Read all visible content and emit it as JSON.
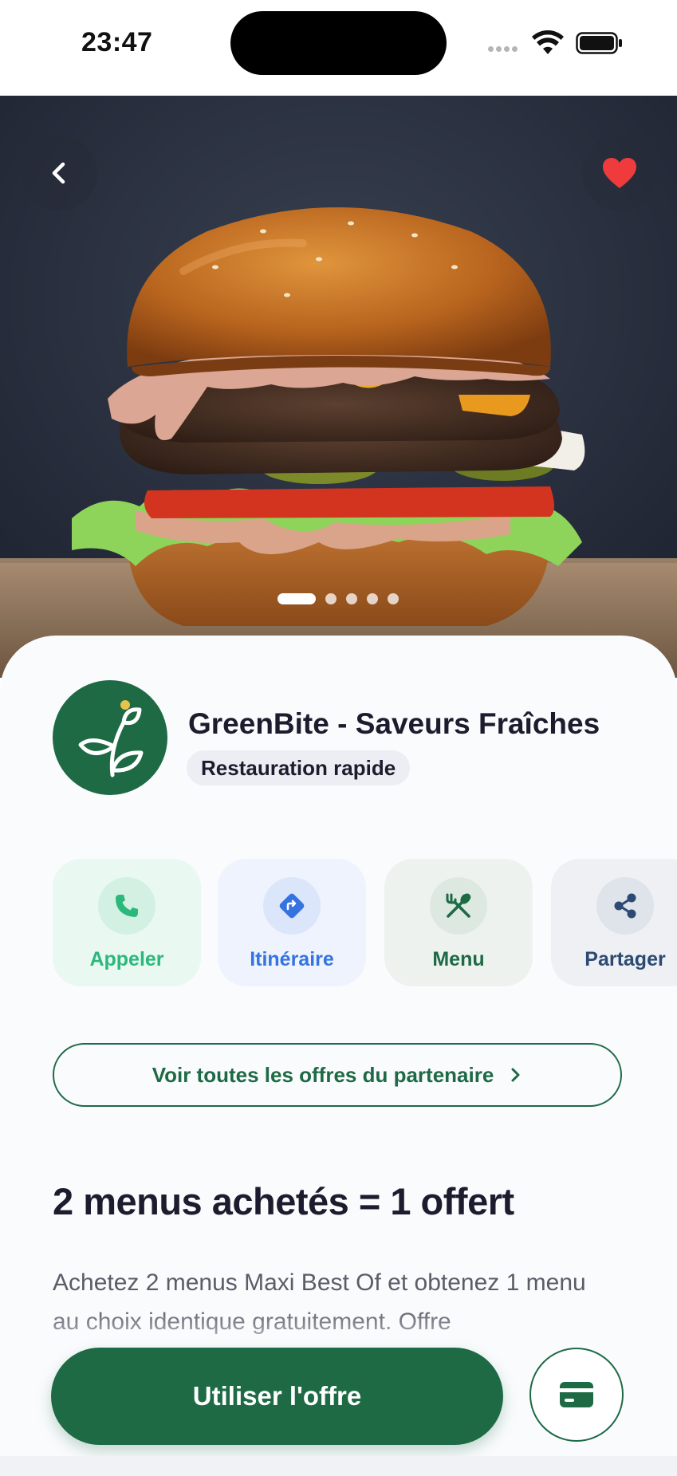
{
  "status_bar": {
    "time": "23:47"
  },
  "hero": {
    "image": "burger-photo",
    "carousel": {
      "total": 5,
      "active_index": 1
    },
    "back_icon": "chevron-left-icon",
    "favorite_icon": "heart-icon",
    "favorite_color": "#ef3b3b"
  },
  "partner": {
    "name": "GreenBite - Saveurs Fraîches",
    "category": "Restauration rapide",
    "logo_icon": "leaf-logo-icon",
    "brand_color": "#1d6a45"
  },
  "actions": [
    {
      "label": "Appeler",
      "icon": "phone-icon",
      "color": "#2bb87b"
    },
    {
      "label": "Itinéraire",
      "icon": "directions-icon",
      "color": "#3574e0"
    },
    {
      "label": "Menu",
      "icon": "utensils-icon",
      "color": "#1d6a45"
    },
    {
      "label": "Partager",
      "icon": "share-icon",
      "color": "#2c4a72"
    }
  ],
  "offers_link": {
    "label": "Voir toutes les offres du partenaire"
  },
  "offer": {
    "title": "2 menus achetés = 1 offert",
    "description": "Achetez 2 menus Maxi Best Of et obtenez 1 menu au choix identique gratuitement. Offre"
  },
  "footer": {
    "use_button": "Utiliser l'offre",
    "card_icon": "card-icon"
  }
}
